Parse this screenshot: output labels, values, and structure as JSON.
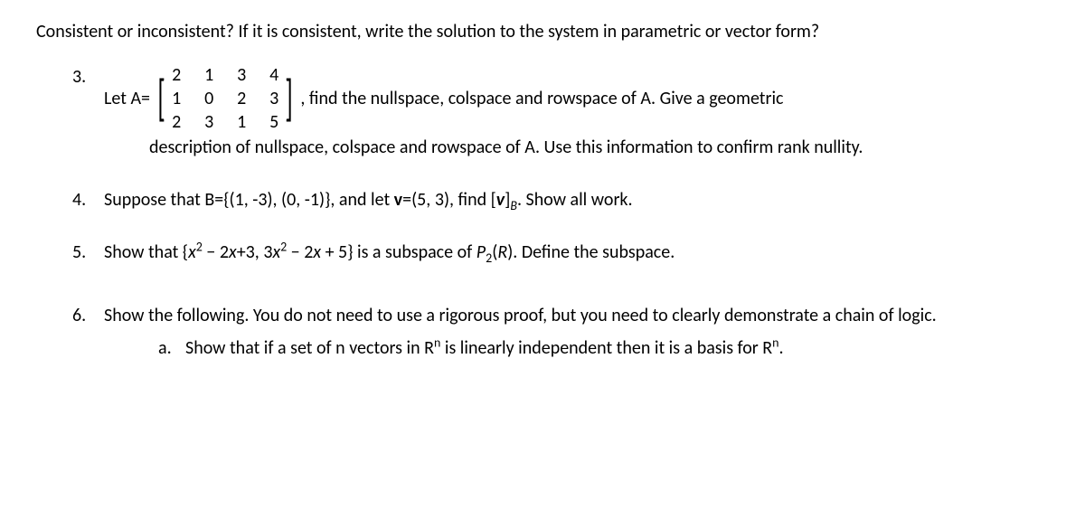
{
  "preamble": "Consistent or inconsistent?  If it is consistent, write the solution to the system in parametric or vector form?",
  "p3": {
    "num": "3.",
    "text_before": "Let A=",
    "matrix": [
      [
        "2",
        "1",
        "3",
        "4"
      ],
      [
        "1",
        "0",
        "2",
        "3"
      ],
      [
        "2",
        "3",
        "1",
        "5"
      ]
    ],
    "text_after": ", find the nullspace, colspace and rowspace of A.  Give a geometric",
    "text_cont": "description of nullspace, colspace and rowspace of A.  Use this information to confirm rank nullity."
  },
  "p4": {
    "num": "4.",
    "text1": "Suppose that B={(1, -3), (0, -1)}, and let ",
    "vbold": "v",
    "text2": "=(5, 3), find ",
    "bracket_open": "[",
    "v_italic": "v",
    "bracket_close": "]",
    "sub_b": "B",
    "text3": ". Show all work."
  },
  "p5": {
    "num": "5.",
    "text1": "Show that {",
    "x": "x",
    "sq": "2",
    "text2": " − 2",
    "text_x": "+3, 3",
    "text3": " − 2",
    "text4": " + 5} is a subspace of ",
    "P": "P",
    "sub2": "2",
    "R": "R",
    "text5": "). Define the subspace."
  },
  "p6": {
    "num": "6.",
    "text": "Show the following.  You do not need to use a rigorous proof, but you need to clearly demonstrate a chain of logic.",
    "sub_a": {
      "label": "a.",
      "text1": "Show that if a set of n vectors in R",
      "sup_n": "n",
      "text2": " is linearly independent then it is a basis for R",
      "text3": "."
    }
  }
}
